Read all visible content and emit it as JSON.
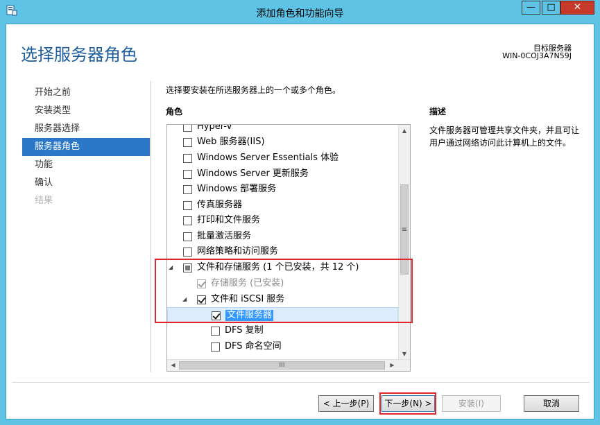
{
  "window": {
    "title": "添加角色和功能向导",
    "min_glyph": "—",
    "max_glyph": "□",
    "close_glyph": "✕"
  },
  "header": {
    "page_title": "选择服务器角色",
    "dest_label": "目标服务器",
    "dest_value": "WIN-0COJ3A7N59J"
  },
  "nav": {
    "items": [
      {
        "label": "开始之前",
        "state": "normal"
      },
      {
        "label": "安装类型",
        "state": "normal"
      },
      {
        "label": "服务器选择",
        "state": "normal"
      },
      {
        "label": "服务器角色",
        "state": "active"
      },
      {
        "label": "功能",
        "state": "normal"
      },
      {
        "label": "确认",
        "state": "normal"
      },
      {
        "label": "结果",
        "state": "disabled"
      }
    ]
  },
  "main": {
    "instruction": "选择要安装在所选服务器上的一个或多个角色。",
    "roles_heading": "角色",
    "description_heading": "描述",
    "description_text": "文件服务器可管理共享文件夹，并且可让用户通过网络访问此计算机上的文件。"
  },
  "tree": {
    "rows": [
      {
        "label": "Hyper-V",
        "checkbox": "unchecked",
        "expander": ""
      },
      {
        "label": "Web 服务器(IIS)",
        "checkbox": "unchecked",
        "expander": ""
      },
      {
        "label": "Windows Server Essentials 体验",
        "checkbox": "unchecked",
        "expander": ""
      },
      {
        "label": "Windows Server 更新服务",
        "checkbox": "unchecked",
        "expander": ""
      },
      {
        "label": "Windows 部署服务",
        "checkbox": "unchecked",
        "expander": ""
      },
      {
        "label": "传真服务器",
        "checkbox": "unchecked",
        "expander": ""
      },
      {
        "label": "打印和文件服务",
        "checkbox": "unchecked",
        "expander": ""
      },
      {
        "label": "批量激活服务",
        "checkbox": "unchecked",
        "expander": ""
      },
      {
        "label": "网络策略和访问服务",
        "checkbox": "unchecked",
        "expander": ""
      },
      {
        "label": "文件和存储服务 (1 个已安装，共 12 个)",
        "checkbox": "partial",
        "expander": "◢"
      },
      {
        "label": "存储服务 (已安装)",
        "checkbox": "checked-grey",
        "expander": ""
      },
      {
        "label": "文件和 iSCSI 服务",
        "checkbox": "checked",
        "expander": "◢"
      },
      {
        "label": "文件服务器",
        "checkbox": "checked",
        "expander": "",
        "selected": true
      },
      {
        "label": "DFS 复制",
        "checkbox": "unchecked",
        "expander": ""
      },
      {
        "label": "DFS 命名空间",
        "checkbox": "unchecked",
        "expander": ""
      }
    ]
  },
  "scroll": {
    "up_glyph": "▲",
    "down_glyph": "▼",
    "left_glyph": "◀",
    "right_glyph": "▶",
    "vthumb_glyph": "≡",
    "hthumb_glyph": "III"
  },
  "buttons": {
    "prev": "< 上一步(P)",
    "next": "下一步(N) >",
    "install": "安装(I)",
    "cancel": "取消"
  }
}
